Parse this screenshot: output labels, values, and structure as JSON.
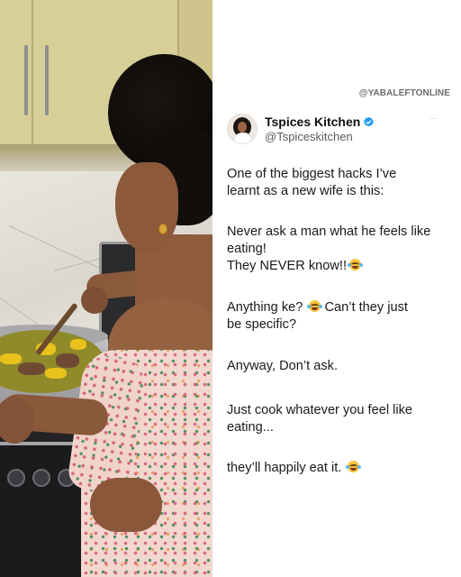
{
  "watermark": "@YABALEFTONLINE",
  "post": {
    "author": {
      "display_name": "Tspices Kitchen",
      "handle": "@Tspiceskitchen",
      "verified": true,
      "verified_color": "#1d9bf0"
    },
    "paragraphs": [
      {
        "lines": [
          "One of the biggest hacks I’ve",
          "learnt as a new wife is this:"
        ]
      },
      {
        "lines": [
          "Never ask a man what he feels like",
          "eating!",
          "They NEVER know!!"
        ],
        "emoji_on_line": 2
      },
      {
        "lines": [
          " Anything ke?  Can’t they just",
          "be specific?"
        ],
        "emoji": "rolling-on-floor-laughing"
      },
      {
        "lines": [
          "Anyway, Don’t ask."
        ]
      },
      {
        "lines": [
          "Just cook whatever you feel like",
          "eating..."
        ]
      },
      {
        "lines": [
          " they’ll happily eat it."
        ],
        "emoji_on_line": 0
      }
    ],
    "p3_part1": " Anything ke?",
    "p3_part2": " Can’t they just",
    "p3_line2": "be specific?"
  },
  "photo": {
    "description_icon": "kitchen-photo",
    "colors": {
      "cabinet": "#d8cf98",
      "dress": "#f2d7cf",
      "stew": "#e9c21c"
    }
  }
}
